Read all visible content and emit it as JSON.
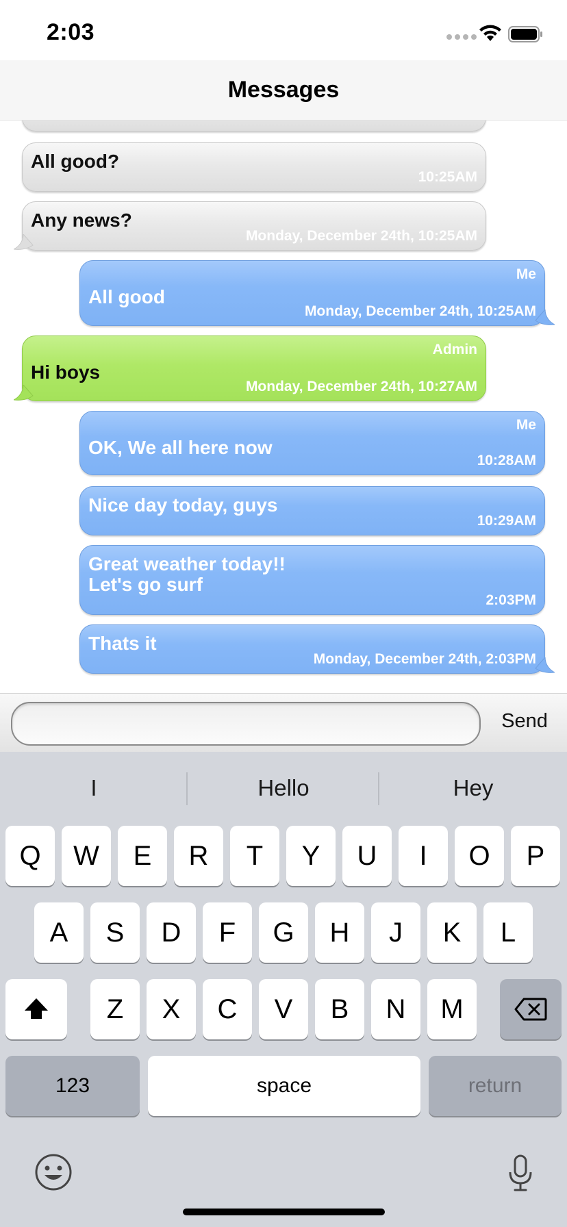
{
  "status_bar": {
    "time": "2:03"
  },
  "nav": {
    "title": "Messages"
  },
  "messages": [
    {
      "text": "All good?",
      "timestamp": "10:25AM"
    },
    {
      "text": "Any news?",
      "timestamp": "Monday, December 24th, 10:25AM"
    },
    {
      "sender": "Me",
      "text": "All good",
      "timestamp": "Monday, December 24th, 10:25AM"
    },
    {
      "sender": "Admin",
      "text": "Hi boys",
      "timestamp": "Monday, December 24th, 10:27AM"
    },
    {
      "sender": "Me",
      "text": "OK, We all here now",
      "timestamp": "10:28AM"
    },
    {
      "text": "Nice day today, guys",
      "timestamp": "10:29AM"
    },
    {
      "text_line1": "Great weather today!!",
      "text_line2": "Let's go surf",
      "timestamp": "2:03PM"
    },
    {
      "text": "Thats it",
      "timestamp": "Monday, December 24th, 2:03PM"
    }
  ],
  "input": {
    "value": "",
    "send_label": "Send"
  },
  "keyboard": {
    "suggestions": [
      "I",
      "Hello",
      "Hey"
    ],
    "row1": [
      "Q",
      "W",
      "E",
      "R",
      "T",
      "Y",
      "U",
      "I",
      "O",
      "P"
    ],
    "row2": [
      "A",
      "S",
      "D",
      "F",
      "G",
      "H",
      "J",
      "K",
      "L"
    ],
    "row3": [
      "Z",
      "X",
      "C",
      "V",
      "B",
      "N",
      "M"
    ],
    "numbers_label": "123",
    "space_label": "space",
    "return_label": "return"
  },
  "colors": {
    "outgoing_bubble": "#87b8f8",
    "incoming_bubble": "#e9e9e9",
    "admin_bubble": "#afe866",
    "keyboard_bg": "#d3d6dc"
  },
  "icons": [
    "wifi-icon",
    "battery-icon",
    "shift-icon",
    "backspace-icon",
    "emoji-icon",
    "microphone-icon"
  ]
}
